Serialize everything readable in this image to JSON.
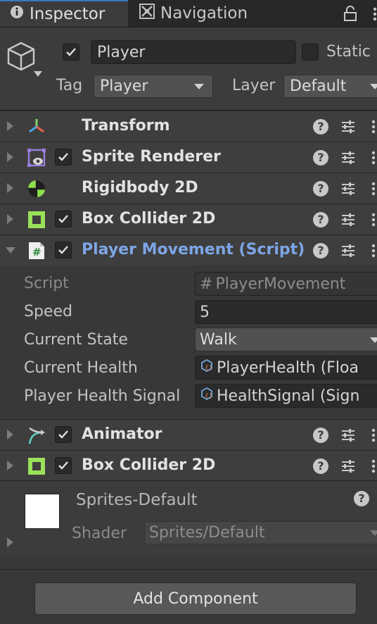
{
  "tabs": [
    {
      "label": "Inspector",
      "icon": "info-icon",
      "active": true
    },
    {
      "label": "Navigation",
      "icon": "navigation-icon",
      "active": false
    }
  ],
  "header": {
    "active": true,
    "name": "Player",
    "static_label": "Static",
    "tag_label": "Tag",
    "tag_value": "Player",
    "layer_label": "Layer",
    "layer_value": "Default"
  },
  "components": [
    {
      "name": "Transform",
      "icon": "transform-icon",
      "has_checkbox": false,
      "expanded": false
    },
    {
      "name": "Sprite Renderer",
      "icon": "sprite-renderer-icon",
      "has_checkbox": true,
      "expanded": false
    },
    {
      "name": "Rigidbody 2D",
      "icon": "rigidbody2d-icon",
      "has_checkbox": false,
      "expanded": false
    },
    {
      "name": "Box Collider 2D",
      "icon": "box-collider-icon",
      "has_checkbox": true,
      "expanded": false
    },
    {
      "name": "Player Movement (Script)",
      "icon": "script-icon",
      "has_checkbox": true,
      "expanded": true
    },
    {
      "name": "Animator",
      "icon": "animator-icon",
      "has_checkbox": true,
      "expanded": false
    },
    {
      "name": "Box Collider 2D",
      "icon": "box-collider-icon",
      "has_checkbox": true,
      "expanded": false
    }
  ],
  "script_properties": {
    "script_label": "Script",
    "script_value": "PlayerMovement",
    "speed_label": "Speed",
    "speed_value": "5",
    "state_label": "Current State",
    "state_value": "Walk",
    "health_label": "Current Health",
    "health_value": "PlayerHealth (Floa",
    "signal_label": "Player Health Signal",
    "signal_value": "HealthSignal (Sign"
  },
  "material": {
    "name": "Sprites-Default",
    "shader_label": "Shader",
    "shader_value": "Sprites/Default"
  },
  "add_component_label": "Add Component",
  "colors": {
    "script_title": "#7da6e6",
    "tab_accent": "#3a79bb",
    "rigidbody": "#8fe04d",
    "collider": "#9be05a"
  }
}
